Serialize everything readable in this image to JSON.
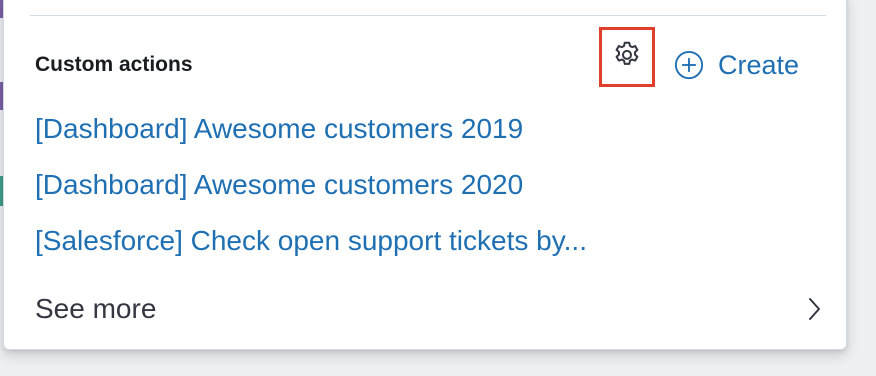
{
  "custom_actions": {
    "title": "Custom actions",
    "create_label": "Create",
    "links": [
      {
        "label": "[Dashboard] Awesome customers 2019"
      },
      {
        "label": "[Dashboard] Awesome customers 2020"
      },
      {
        "label": "[Salesforce] Check open support tickets by..."
      }
    ],
    "see_more_label": "See more"
  },
  "icons": {
    "settings": "gear-icon",
    "create": "plus-circle-icon",
    "see_more": "chevron-right-icon"
  },
  "colors": {
    "link": "#1f6fb3",
    "highlight_box": "#e0402b",
    "title_text": "#1a1c21",
    "body_text": "#343741"
  }
}
